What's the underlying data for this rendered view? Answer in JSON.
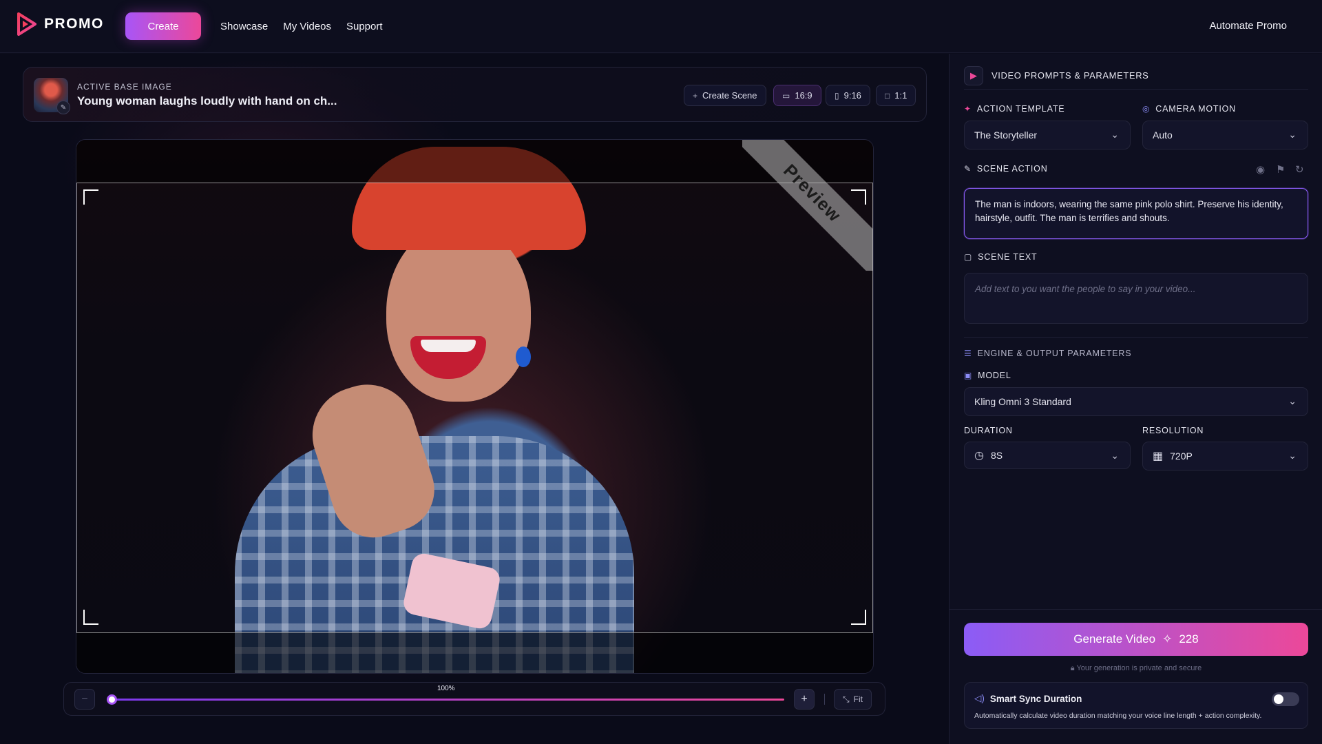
{
  "header": {
    "logo_text": "PROMO",
    "create_label": "Create",
    "nav": [
      "Showcase",
      "My Videos",
      "Support"
    ],
    "automate_label": "Automate Promo"
  },
  "base_image": {
    "label": "ACTIVE BASE IMAGE",
    "title": "Young woman laughs loudly with hand on ch...",
    "create_scene_label": "Create Scene",
    "aspect_ratios": [
      {
        "label": "16:9",
        "active": true
      },
      {
        "label": "9:16",
        "active": false
      },
      {
        "label": "1:1",
        "active": false
      }
    ]
  },
  "preview": {
    "ribbon_text": "Preview"
  },
  "zoom": {
    "value_label": "100%",
    "fit_label": "Fit",
    "minus": "−",
    "plus": "+"
  },
  "panel": {
    "section_title": "VIDEO PROMPTS & PARAMETERS",
    "action_template_label": "ACTION TEMPLATE",
    "action_template_value": "The Storyteller",
    "camera_motion_label": "CAMERA MOTION",
    "camera_motion_value": "Auto",
    "scene_action_label": "SCENE ACTION",
    "scene_action_text": "The man is indoors, wearing the same pink polo shirt. Preserve his identity, hairstyle, outfit. The man is terrifies and shouts.",
    "scene_text_label": "SCENE TEXT",
    "scene_text_placeholder": "Add text to you want the people to say in your video...",
    "engine_label": "ENGINE & OUTPUT PARAMETERS",
    "model_label": "MODEL",
    "model_value": "Kling Omni 3 Standard",
    "duration_label": "DURATION",
    "duration_value": "8S",
    "resolution_label": "RESOLUTION",
    "resolution_value": "720P",
    "generate_label": "Generate Video",
    "generate_credits": "228",
    "private_note": "Your generation is private and secure",
    "sync_title": "Smart Sync Duration",
    "sync_desc": "Automatically calculate video duration matching your voice line length + action complexity.",
    "sync_enabled": false
  },
  "colors": {
    "accent_purple": "#8b5cf6",
    "accent_pink": "#ec4899",
    "background": "#0c0d1c"
  }
}
